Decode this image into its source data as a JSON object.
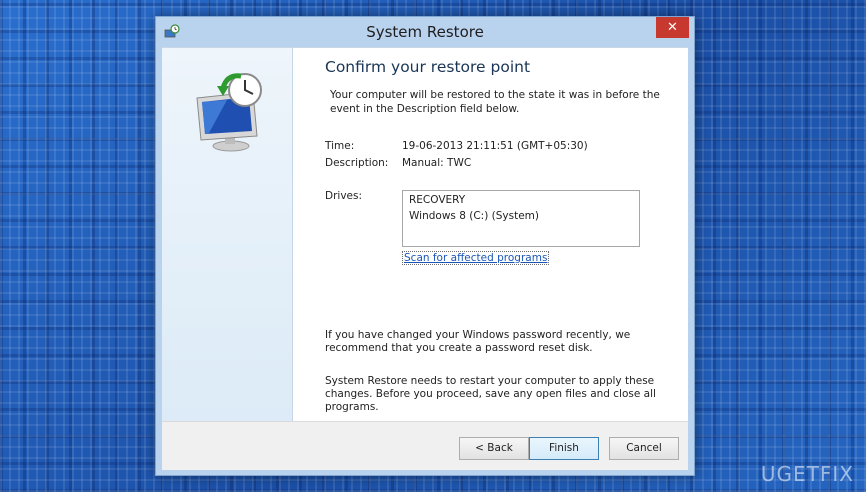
{
  "window": {
    "title": "System Restore",
    "close_glyph": "✕"
  },
  "page": {
    "heading": "Confirm your restore point",
    "intro": "Your computer will be restored to the state it was in before the event in the Description field below.",
    "time_label": "Time:",
    "time_value": "19-06-2013 21:11:51 (GMT+05:30)",
    "description_label": "Description:",
    "description_value": "Manual: TWC",
    "drives_label": "Drives:",
    "drives": [
      "RECOVERY",
      "Windows 8 (C:) (System)"
    ],
    "scan_link": "Scan for affected programs",
    "password_note": "If you have changed your Windows password recently, we recommend that you create a password reset disk.",
    "restart_note": "System Restore needs to restart your computer to apply these changes. Before you proceed, save any open files and close all programs."
  },
  "buttons": {
    "back": "< Back",
    "finish": "Finish",
    "cancel": "Cancel"
  },
  "watermark": "UGETFIX",
  "colors": {
    "close": "#c7392f",
    "link": "#1a56b8",
    "desktop": "#1f5fb8"
  },
  "icons": [
    "system-restore-icon",
    "restore-monitor-clock-icon",
    "close-icon"
  ]
}
